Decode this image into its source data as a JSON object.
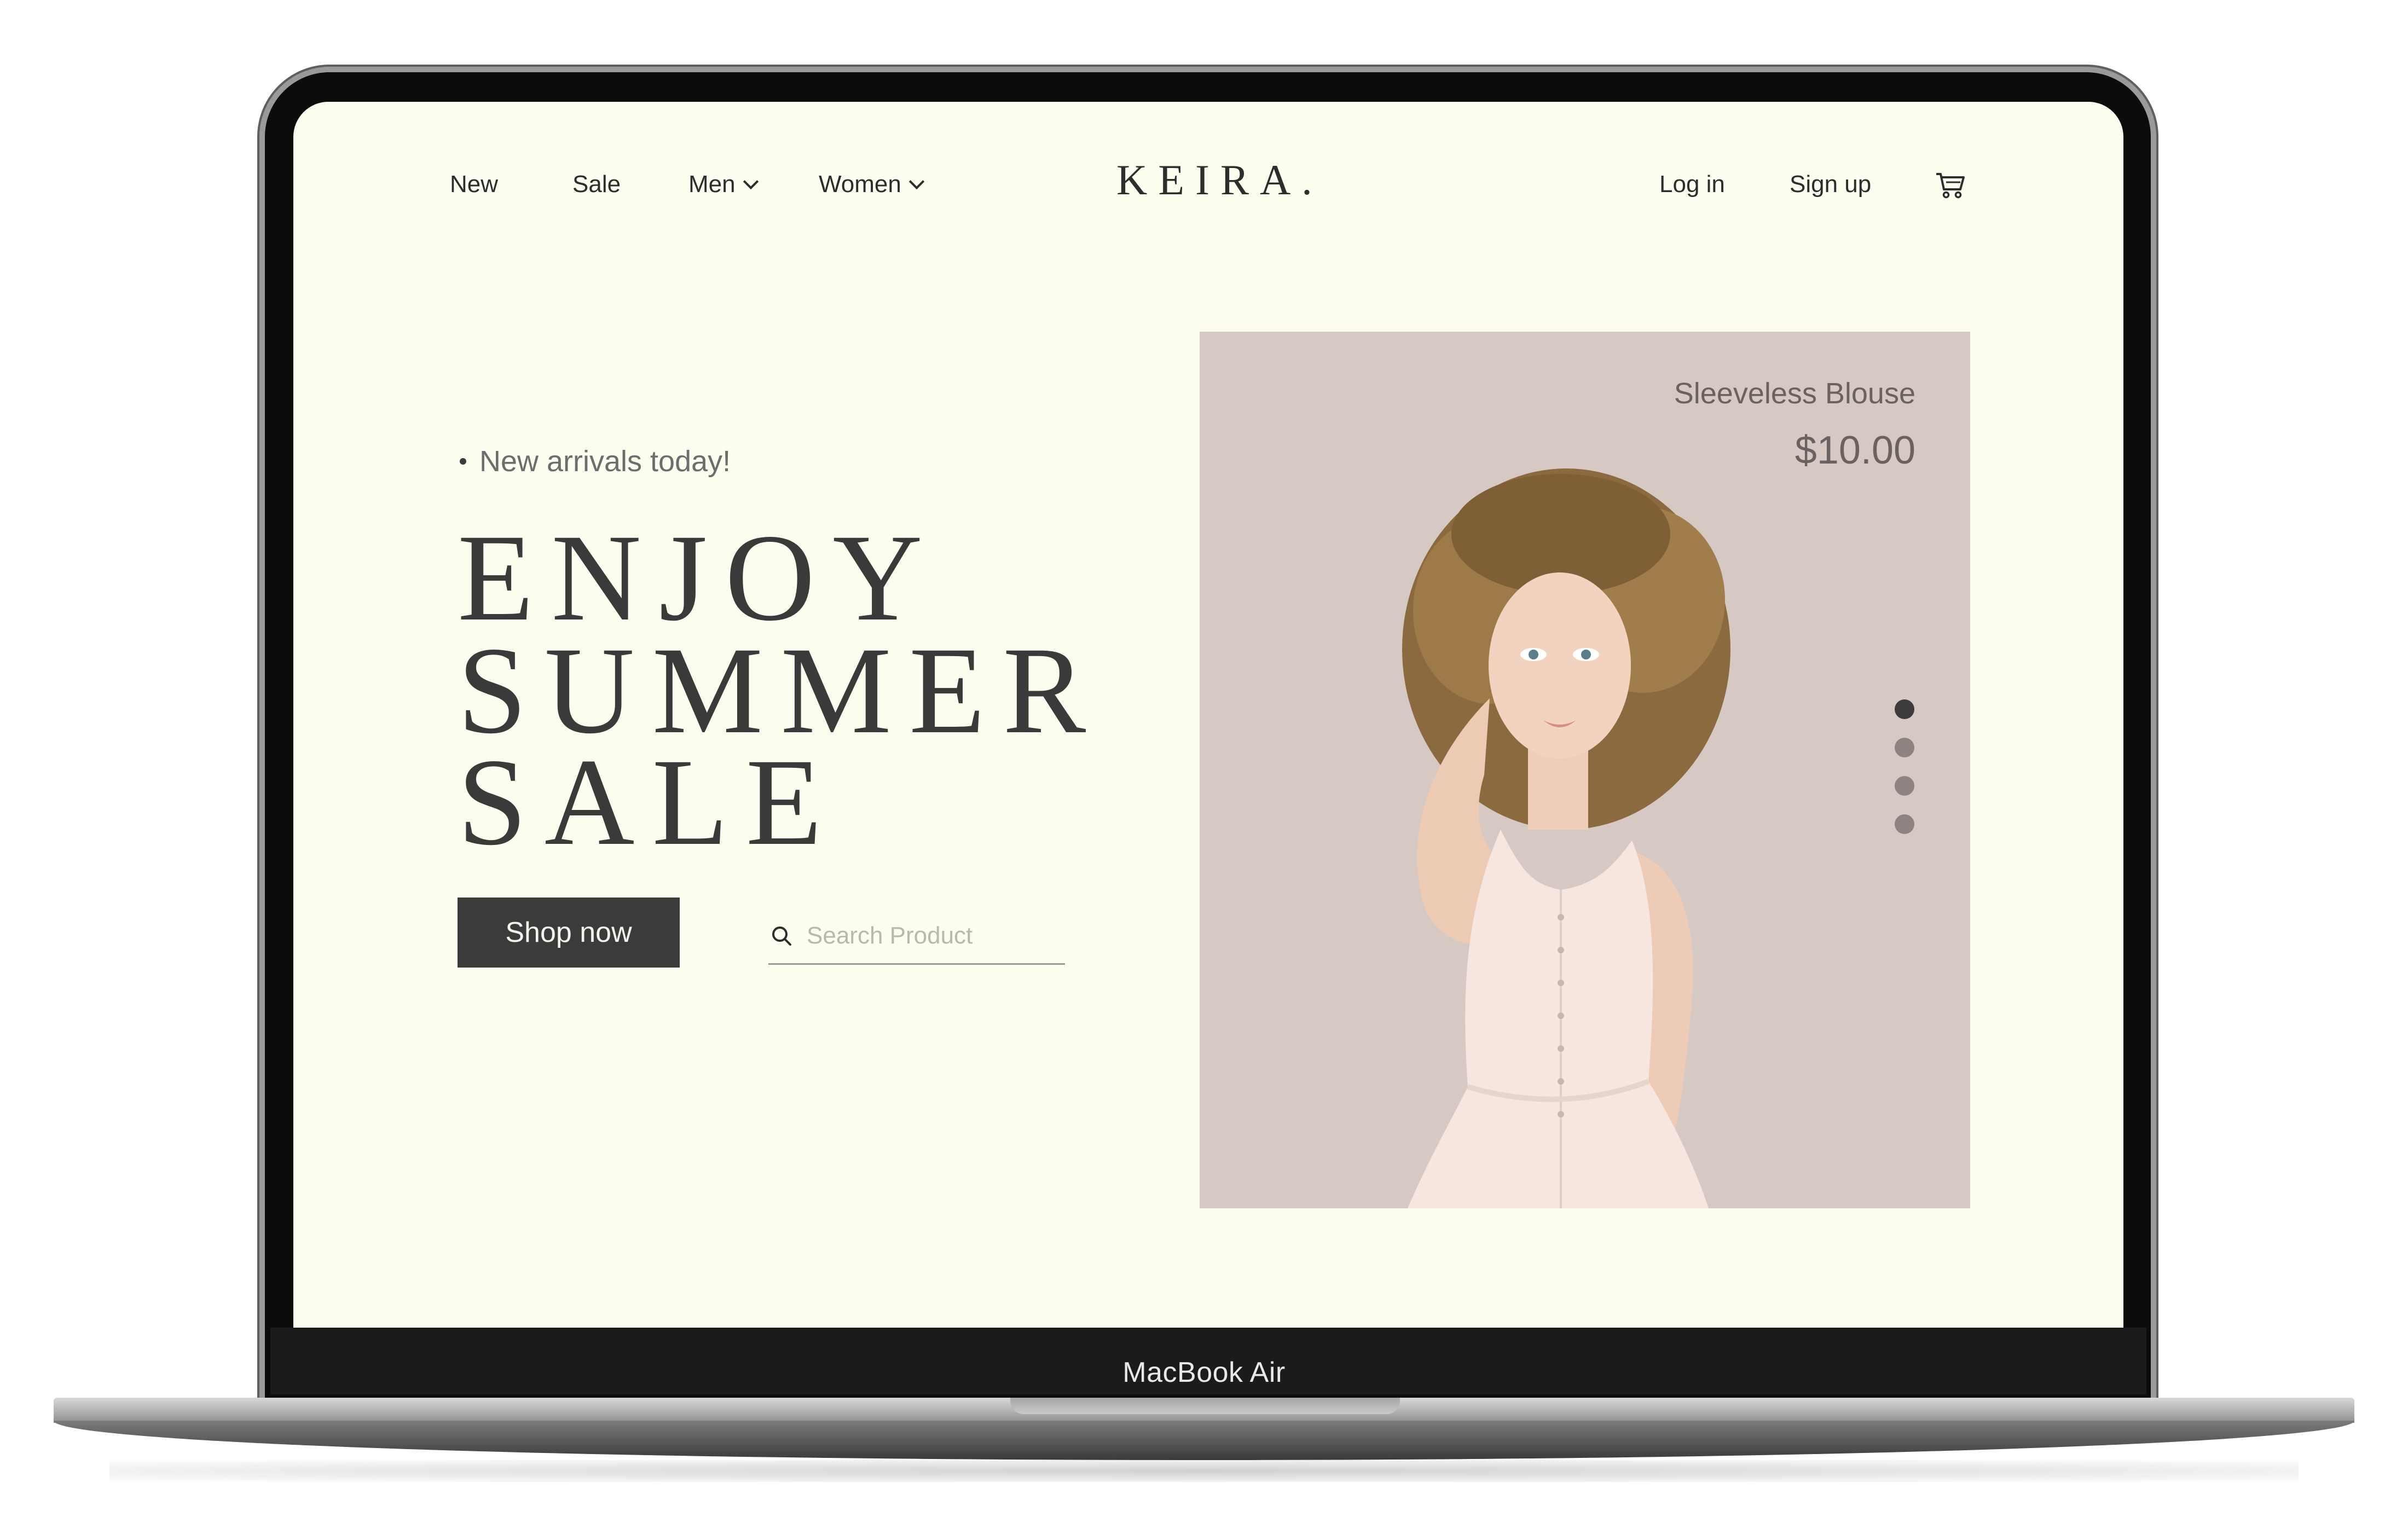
{
  "nav": {
    "left": [
      {
        "label": "New"
      },
      {
        "label": "Sale"
      },
      {
        "label": "Men"
      },
      {
        "label": "Women"
      }
    ],
    "brand": "KEIRA.",
    "right": [
      {
        "label": "Log in"
      },
      {
        "label": "Sign up"
      }
    ],
    "cart_icon": "cart-icon"
  },
  "hero": {
    "tagline": "New arrivals today!",
    "headline": [
      "ENJOY",
      "SUMMER",
      "SALE"
    ],
    "cta_label": "Shop now",
    "search_placeholder": "Search Product"
  },
  "product": {
    "name": "Sleeveless Blouse",
    "price": "$10.00",
    "carousel": {
      "count": 4,
      "active": 0
    }
  },
  "device": {
    "label": "MacBook Air"
  },
  "colors": {
    "screen_bg": "#fdfdf0",
    "text_dark": "#3a3a3a",
    "card_bg": "#d6c9c4",
    "button_bg": "#3b3b3b"
  }
}
